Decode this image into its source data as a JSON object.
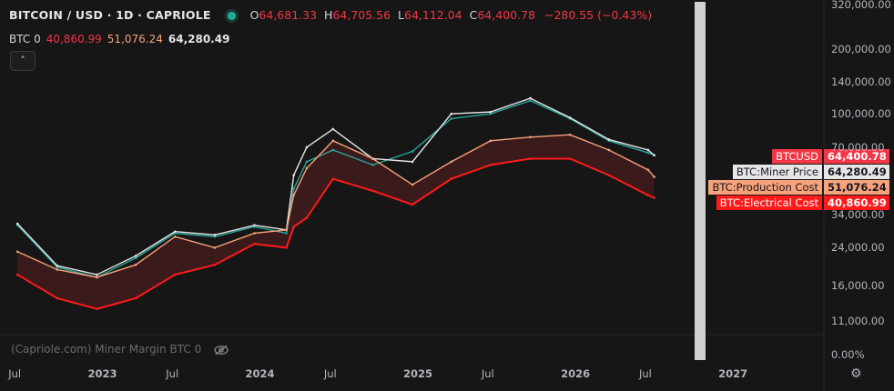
{
  "header": {
    "symbol": "BITCOIN / USD · 1D · CAPRIOLE",
    "open_label": "O",
    "open": "64,681.33",
    "high_label": "H",
    "high": "64,705.56",
    "low_label": "L",
    "low": "64,112.04",
    "close_label": "C",
    "close": "64,400.78",
    "change": "−280.55 (−0.43%)"
  },
  "indicator": {
    "name": "BTC",
    "param": "0",
    "electrical": "40,860.99",
    "production": "51,076.24",
    "miner_price": "64,280.49",
    "collapse_icon": "chevron-up-icon"
  },
  "lower_pane": {
    "label": "(Capriole.com) Miner Margin BTC 0",
    "visibility_icon": "eye-off-icon",
    "axis_label": "0.00%"
  },
  "price_labels": [
    {
      "name": "BTCUSD",
      "value": "64,400.78",
      "bg": "#f23645",
      "fg": "#ffffff"
    },
    {
      "name": "BTC:Miner Price",
      "value": "64,280.49",
      "bg": "#e6e6e6",
      "fg": "#131722"
    },
    {
      "name": "BTC:Production Cost",
      "value": "51,076.24",
      "bg": "#f7a27a",
      "fg": "#131722"
    },
    {
      "name": "BTC:Electrical Cost",
      "value": "40,860.99",
      "bg": "#ff1a1a",
      "fg": "#ffffff"
    }
  ],
  "settings_icon": "gear-icon",
  "chart_data": {
    "type": "line",
    "y_scale": "log",
    "ylim": [
      9500,
      330000
    ],
    "y_ticks": [
      "320,000.00",
      "200,000.00",
      "140,000.00",
      "100,000.00",
      "70,000.00",
      "34,000.00",
      "24,000.00",
      "16,000.00",
      "11,000.00"
    ],
    "x_ticks": [
      "Jul",
      "2023",
      "Jul",
      "2024",
      "Jul",
      "2025",
      "Jul",
      "2026",
      "Jul",
      "2027"
    ],
    "x_ticks_bold": [
      false,
      true,
      false,
      true,
      false,
      true,
      false,
      true,
      false,
      true
    ],
    "x_dates": [
      "2022-07-01",
      "2022-10-01",
      "2023-01-01",
      "2023-04-01",
      "2023-07-01",
      "2023-10-01",
      "2024-01-01",
      "2024-03-15",
      "2024-04-01",
      "2024-05-01",
      "2024-07-01",
      "2024-10-01",
      "2025-01-01",
      "2025-04-01",
      "2025-07-01",
      "2025-10-01",
      "2026-01-01",
      "2026-04-01",
      "2026-07-01",
      "2026-07-15"
    ],
    "series": [
      {
        "name": "BTCUSD",
        "color": "#26a69a",
        "values": [
          30500,
          19500,
          17500,
          21500,
          28000,
          27000,
          30000,
          28000,
          45000,
          60000,
          68000,
          58000,
          67000,
          95000,
          100000,
          115000,
          95000,
          75000,
          66000,
          64400
        ]
      },
      {
        "name": "BTC:Miner Price",
        "color": "#e6e6e6",
        "values": [
          31000,
          19800,
          18000,
          22000,
          28500,
          27500,
          30500,
          29000,
          52000,
          70000,
          85000,
          62000,
          60000,
          100000,
          102000,
          118000,
          96000,
          76000,
          68000,
          64280
        ]
      },
      {
        "name": "BTC:Production Cost",
        "color": "#f7a27a",
        "values": [
          23000,
          19000,
          17500,
          20000,
          27000,
          24000,
          28000,
          29000,
          42000,
          56000,
          75000,
          62000,
          47000,
          60000,
          75000,
          78000,
          80000,
          68000,
          55000,
          51076
        ]
      },
      {
        "name": "BTC:Electrical Cost",
        "color": "#ff1a1a",
        "values": [
          18000,
          14000,
          12500,
          14000,
          18000,
          20000,
          25000,
          24000,
          30000,
          33000,
          50000,
          44000,
          38000,
          50000,
          58000,
          62000,
          62000,
          52000,
          42000,
          40861
        ]
      }
    ]
  }
}
